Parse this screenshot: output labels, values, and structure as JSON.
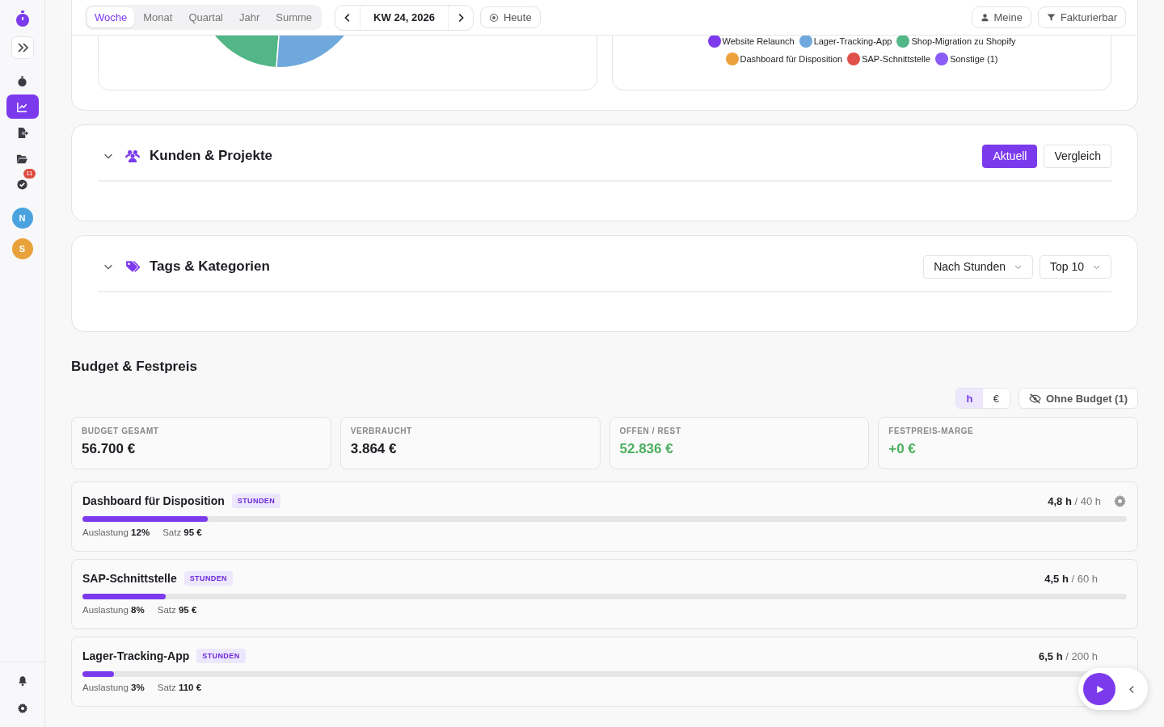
{
  "sidebar": {
    "nav": [
      {
        "kind": "timer",
        "selected": false
      },
      {
        "kind": "chart",
        "selected": true
      },
      {
        "kind": "export",
        "selected": false
      },
      {
        "kind": "folder",
        "selected": false
      },
      {
        "kind": "tasks",
        "selected": false,
        "badge": "11"
      }
    ],
    "avatars": [
      {
        "initial": "N",
        "color": "#4aa3df"
      },
      {
        "initial": "S",
        "color": "#e9a23b"
      }
    ]
  },
  "toolbar": {
    "period_tabs": [
      {
        "label": "Woche",
        "selected": true
      },
      {
        "label": "Monat",
        "selected": false
      },
      {
        "label": "Quartal",
        "selected": false
      },
      {
        "label": "Jahr",
        "selected": false
      },
      {
        "label": "Summe",
        "selected": false
      }
    ],
    "week": "KW 24, 2026",
    "today_button": "Heute",
    "filters": [
      {
        "label": "Meine",
        "kind": "user"
      },
      {
        "label": "Fakturierbar",
        "kind": "filter"
      }
    ]
  },
  "charts": {
    "legend": [
      {
        "label": "Website Relaunch",
        "color": "#7c3aed"
      },
      {
        "label": "Lager-Tracking-App",
        "color": "#6fa8dc"
      },
      {
        "label": "Shop-Migration zu Shopify",
        "color": "#52b686"
      },
      {
        "label": "Dashboard für Disposition",
        "color": "#eba23c"
      },
      {
        "label": "SAP-Schnittstelle",
        "color": "#e0504a"
      },
      {
        "label": "Sonstige (1)",
        "color": "#8b5cf6"
      }
    ]
  },
  "sections": [
    {
      "title": "Kunden & Projekte",
      "kind": "people",
      "controls": [
        {
          "label": "Aktuell",
          "kind": "toggle",
          "selected": true
        },
        {
          "label": "Vergleich",
          "kind": "toggle",
          "selected": false
        }
      ]
    },
    {
      "title": "Tags & Kategorien",
      "kind": "tags",
      "controls": [
        {
          "label": "Nach Stunden",
          "kind": "dropdown"
        },
        {
          "label": "Top 10",
          "kind": "dropdown"
        }
      ]
    }
  ],
  "budget": {
    "title": "Budget & Festpreis",
    "units": [
      {
        "label": "h",
        "selected": true
      },
      {
        "label": "€",
        "selected": false
      }
    ],
    "hide_button": "Ohne Budget (1)",
    "stats": [
      {
        "label": "BUDGET GESAMT",
        "value": "56.700 €",
        "color": "#1c1c22"
      },
      {
        "label": "VERBRAUCHT",
        "value": "3.864 €",
        "color": "#1c1c22"
      },
      {
        "label": "OFFEN / REST",
        "value": "52.836 €",
        "color": "#4caf5f"
      },
      {
        "label": "FESTPREIS-MARGE",
        "value": "+0 €",
        "color": "#4caf5f"
      }
    ],
    "items": [
      {
        "name": "Dashboard für Disposition",
        "badge": "STUNDEN",
        "used": "4,8 h",
        "total": "/ 40 h",
        "settings": true,
        "level": 0.12,
        "utilization_label": "Auslastung",
        "utilization": "12%",
        "rate_label": "Satz",
        "rate": "95 €"
      },
      {
        "name": "SAP-Schnittstelle",
        "badge": "STUNDEN",
        "used": "4,5 h",
        "total": "/ 60 h",
        "settings": false,
        "level": 0.08,
        "utilization_label": "Auslastung",
        "utilization": "8%",
        "rate_label": "Satz",
        "rate": "95 €"
      },
      {
        "name": "Lager-Tracking-App",
        "badge": "STUNDEN",
        "used": "6,5 h",
        "total": "/ 200 h",
        "settings": false,
        "level": 0.03,
        "utilization_label": "Auslastung",
        "utilization": "3%",
        "rate_label": "Satz",
        "rate": "110 €"
      }
    ]
  }
}
